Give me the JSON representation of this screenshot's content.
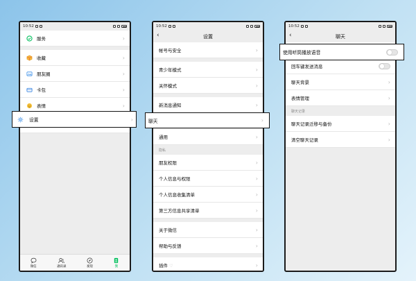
{
  "status": {
    "time": "10:52"
  },
  "colors": {
    "accent": "#07c160",
    "chevron": "#b8b8b8"
  },
  "screen1": {
    "items": [
      {
        "label": "服务",
        "icon": "service-icon"
      },
      {
        "label": "收藏",
        "icon": "favorites-cube-icon"
      },
      {
        "label": "朋友圈",
        "icon": "moments-image-icon"
      },
      {
        "label": "卡包",
        "icon": "card-wallet-icon"
      },
      {
        "label": "表情",
        "icon": "sticker-smile-icon"
      },
      {
        "label": "设置",
        "icon": "settings-gear-icon"
      }
    ],
    "tabs": [
      {
        "label": "微信",
        "icon": "chat-bubble-icon"
      },
      {
        "label": "通讯录",
        "icon": "contacts-icon"
      },
      {
        "label": "发现",
        "icon": "compass-icon"
      },
      {
        "label": "我",
        "icon": "me-person-icon"
      }
    ]
  },
  "screen2": {
    "title": "设置",
    "items": [
      {
        "label": "帐号与安全"
      },
      {
        "label": "青少年模式"
      },
      {
        "label": "关怀模式"
      },
      {
        "label": "新消息通知"
      },
      {
        "label": "聊天"
      },
      {
        "label": "通用"
      }
    ],
    "privacy_section": "隐私",
    "privacy_items": [
      {
        "label": "朋友权限"
      },
      {
        "label": "个人信息与权限"
      },
      {
        "label": "个人信息收集清单"
      },
      {
        "label": "第三方信息共享清单"
      }
    ],
    "about_items": [
      {
        "label": "关于微信"
      },
      {
        "label": "帮助与反馈"
      }
    ],
    "plugins": {
      "label": "插件"
    }
  },
  "screen3": {
    "title": "聊天",
    "toggle_items": [
      {
        "label": "使用听筒播放语音",
        "on": false
      },
      {
        "label": "回车键发送消息",
        "on": false
      }
    ],
    "items": [
      {
        "label": "聊天背景"
      },
      {
        "label": "表情管理"
      }
    ],
    "history_section": "聊天记录",
    "history_items": [
      {
        "label": "聊天记录迁移与备份"
      },
      {
        "label": "清空聊天记录"
      }
    ]
  }
}
